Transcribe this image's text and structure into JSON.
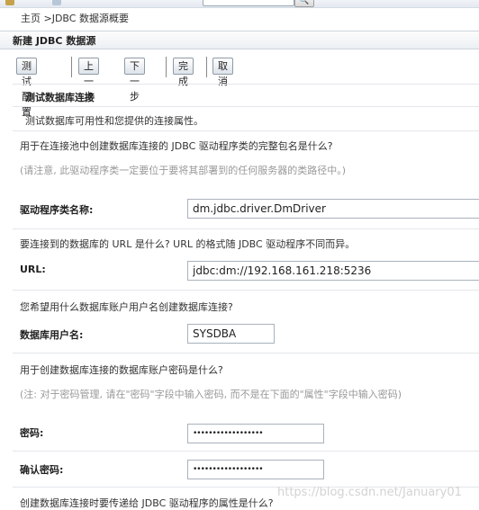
{
  "breadcrumb": {
    "home": "主页",
    "separator": " >",
    "current": "JDBC 数据源概要"
  },
  "panel": {
    "title": "新建 JDBC 数据源"
  },
  "buttons": {
    "test": "测试配置",
    "back": "上一步",
    "next": "下一步",
    "finish": "完成",
    "cancel": "取消"
  },
  "section": {
    "heading": "测试数据库连接",
    "description": "测试数据库可用性和您提供的连接属性。"
  },
  "driver": {
    "question": "用于在连接池中创建数据库连接的 JDBC 驱动程序类的完整包名是什么?",
    "note": "(请注意, 此驱动程序类一定要位于要将其部署到的任何服务器的类路径中。)",
    "label": "驱动程序类名称:",
    "value": "dm.jdbc.driver.DmDriver"
  },
  "url": {
    "question": "要连接到的数据库的 URL 是什么? URL 的格式随 JDBC 驱动程序不同而异。",
    "label": "URL:",
    "value": "jdbc:dm://192.168.161.218:5236"
  },
  "user": {
    "question": "您希望用什么数据库账户用户名创建数据库连接?",
    "label": "数据库用户名:",
    "value": "SYSDBA"
  },
  "password": {
    "question": "用于创建数据库连接的数据库账户密码是什么?",
    "note": "(注: 对于密码管理, 请在\"密码\"字段中输入密码, 而不是在下面的\"属性\"字段中输入密码)",
    "label": "密码:",
    "value": "••••••••••••••••••",
    "confirm_label": "确认密码:",
    "confirm_value": "••••••••••••••••••"
  },
  "properties": {
    "question": "创建数据库连接时要传递给 JDBC 驱动程序的属性是什么?"
  },
  "watermark": "https://blog.csdn.net/January01"
}
